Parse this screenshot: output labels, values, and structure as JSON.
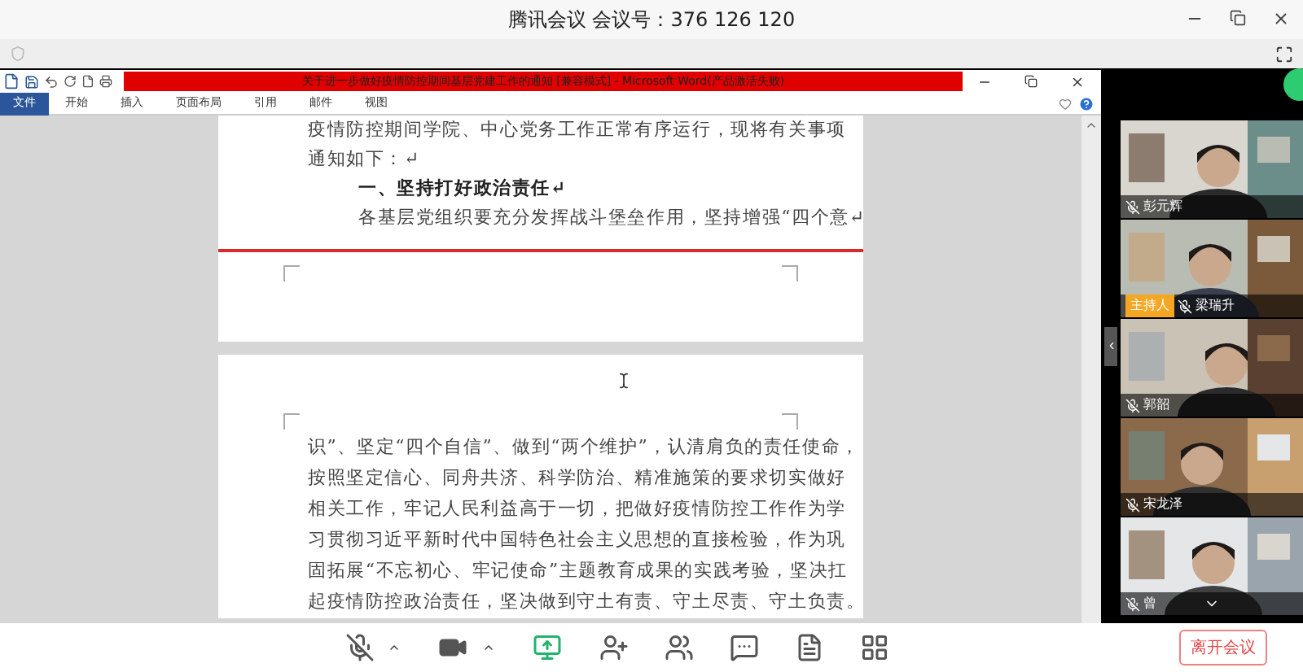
{
  "window": {
    "title": "腾讯会议 会议号：376 126 120"
  },
  "word": {
    "title": "关于进一步做好疫情防控期间基层党建工作的通知 [兼容模式] - Microsoft Word(产品激活失败)",
    "tabs": [
      {
        "label": "文件",
        "kind": "file"
      },
      {
        "label": "开始",
        "kind": "tab"
      },
      {
        "label": "插入",
        "kind": "tab"
      },
      {
        "label": "页面布局",
        "kind": "tab"
      },
      {
        "label": "引用",
        "kind": "tab"
      },
      {
        "label": "邮件",
        "kind": "tab"
      },
      {
        "label": "视图",
        "kind": "tab"
      }
    ],
    "pages": [
      {
        "lines": [
          {
            "kind": "text",
            "text": "疫情防控期间学院、中心党务工作正常有序运行，现将有关事项"
          },
          {
            "kind": "text",
            "text": "通知如下：↵"
          },
          {
            "kind": "heading",
            "text": "一、坚持打好政治责任↵"
          },
          {
            "kind": "indent",
            "text": "各基层党组织要充分发挥战斗堡垒作用，坚持增强“四个意↵"
          }
        ]
      },
      {
        "lines": [
          {
            "kind": "text",
            "text": "识”、坚定“四个自信”、做到“两个维护”，认清肩负的责任使命，"
          },
          {
            "kind": "text",
            "text": "按照坚定信心、同舟共济、科学防治、精准施策的要求切实做好"
          },
          {
            "kind": "text",
            "text": "相关工作，牢记人民利益高于一切，把做好疫情防控工作作为学"
          },
          {
            "kind": "text",
            "text": "习贯彻习近平新时代中国特色社会主义思想的直接检验，作为巩"
          },
          {
            "kind": "text",
            "text": "固拓展“不忘初心、牢记使命”主题教育成果的实践考验，坚决扛"
          },
          {
            "kind": "text",
            "text": "起疫情防控政治责任，坚决做到守土有责、守土尽责、守土负责。"
          }
        ]
      }
    ]
  },
  "participants": [
    {
      "name": "彭元辉",
      "muted": true
    },
    {
      "name": "梁瑞升",
      "muted": true,
      "badge": "主持人"
    },
    {
      "name": "郭韶",
      "muted": true
    },
    {
      "name": "宋龙泽",
      "muted": true
    },
    {
      "name": "曾",
      "muted": true
    }
  ],
  "toolbar": {
    "buttons": [
      {
        "kind": "mic",
        "muted": true
      },
      {
        "kind": "camera"
      },
      {
        "kind": "share",
        "selected": true
      },
      {
        "kind": "invite"
      },
      {
        "kind": "members"
      },
      {
        "kind": "chat"
      },
      {
        "kind": "docs"
      },
      {
        "kind": "apps"
      }
    ],
    "leave": "离开会议"
  }
}
